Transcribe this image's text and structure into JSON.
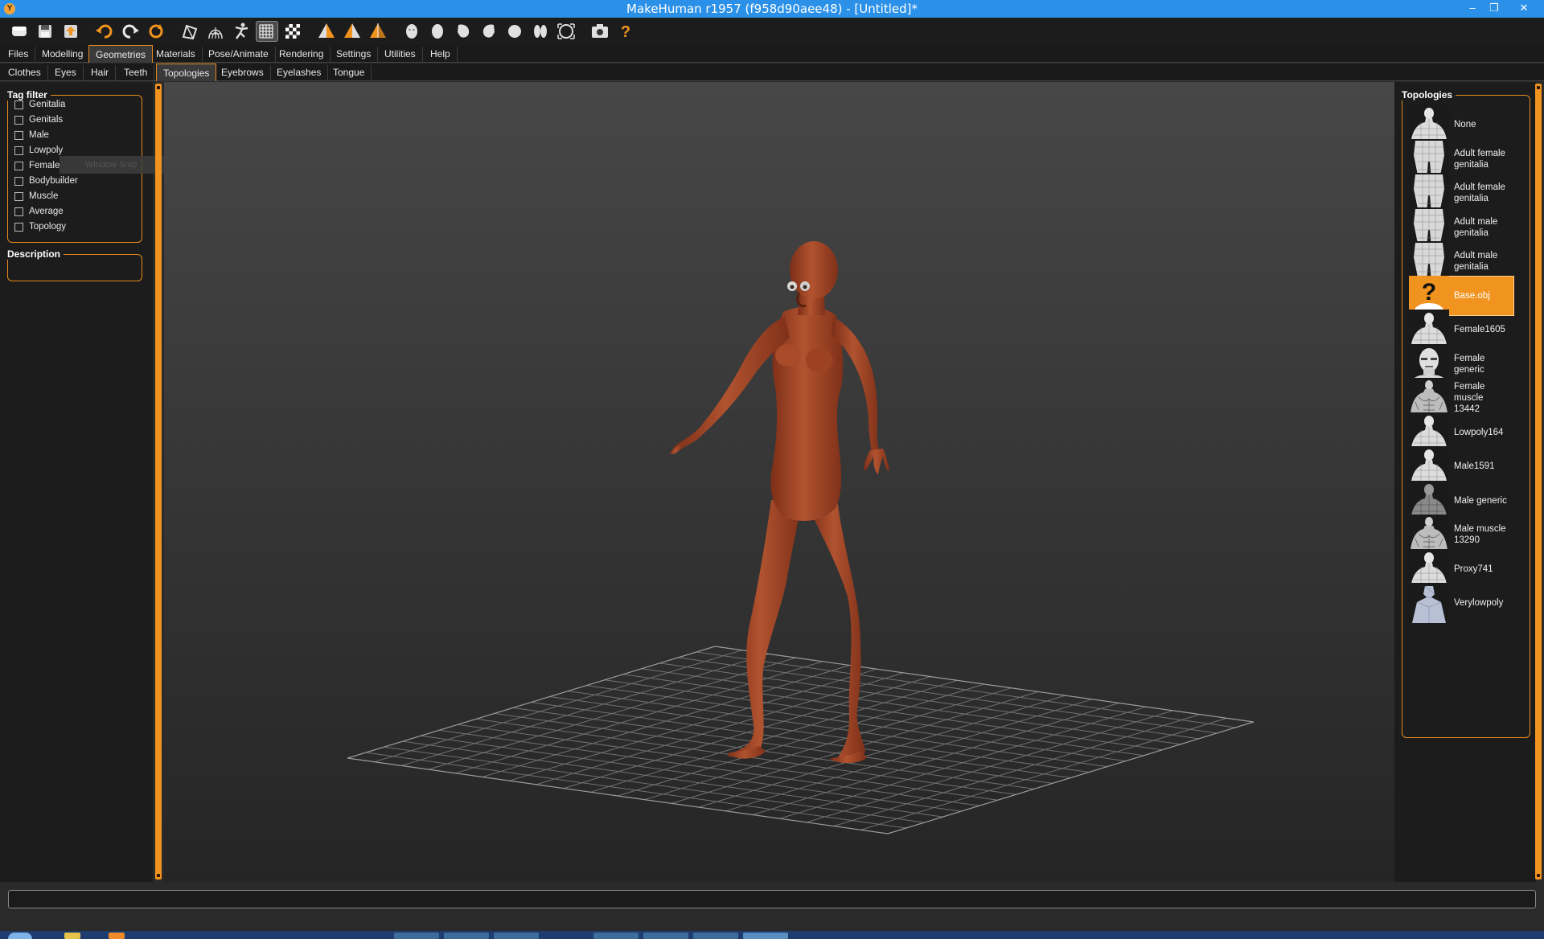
{
  "window": {
    "title": "MakeHuman r1957 (f958d90aee48) - [Untitled]*",
    "app_icon": "makehuman-logo-icon",
    "controls": [
      "minimize-icon",
      "restore-icon",
      "close-icon"
    ]
  },
  "toolbar": {
    "buttons": [
      {
        "name": "new-icon"
      },
      {
        "name": "save-icon"
      },
      {
        "name": "export-icon"
      },
      {
        "name": "undo-icon"
      },
      {
        "name": "redo-icon"
      },
      {
        "name": "reset-icon"
      },
      {
        "name": "smooth-icon"
      },
      {
        "name": "wireframe-icon"
      },
      {
        "name": "pose-icon"
      },
      {
        "name": "grid-icon",
        "active": true
      },
      {
        "name": "checker-background-icon"
      },
      {
        "name": "symmetry-right-icon"
      },
      {
        "name": "symmetry-left-icon"
      },
      {
        "name": "symmetry-icon"
      },
      {
        "name": "front-view-icon"
      },
      {
        "name": "back-view-icon"
      },
      {
        "name": "left-view-icon"
      },
      {
        "name": "right-view-icon"
      },
      {
        "name": "top-view-icon"
      },
      {
        "name": "bottom-view-icon"
      },
      {
        "name": "reset-camera-icon"
      },
      {
        "name": "screenshot-icon"
      },
      {
        "name": "help-icon"
      }
    ]
  },
  "menu": {
    "tabs": [
      "Files",
      "Modelling",
      "Geometries",
      "Materials",
      "Pose/Animate",
      "Rendering",
      "Settings",
      "Utilities",
      "Help"
    ],
    "active": "Geometries"
  },
  "subtabs": {
    "tabs": [
      "Clothes",
      "Eyes",
      "Hair",
      "Teeth",
      "Topologies",
      "Eyebrows",
      "Eyelashes",
      "Tongue"
    ],
    "active": "Topologies"
  },
  "left_panel": {
    "tag_filter": {
      "title": "Tag filter",
      "tags": [
        "Genitalia",
        "Genitals",
        "Male",
        "Lowpoly",
        "Female",
        "Bodybuilder",
        "Muscle",
        "Average",
        "Topology"
      ]
    },
    "description": {
      "title": "Description"
    },
    "tooltip": "Window Snip"
  },
  "right_panel": {
    "title": "Topologies",
    "items": [
      {
        "label": "None",
        "thumb": "male"
      },
      {
        "label": "Adult female\ngenitalia",
        "thumb": "torso"
      },
      {
        "label": "Adult female\ngenitalia",
        "thumb": "torso"
      },
      {
        "label": "Adult male\ngenitalia",
        "thumb": "torso"
      },
      {
        "label": "Adult male\ngenitalia",
        "thumb": "torso"
      },
      {
        "label": "Base.obj",
        "thumb": "unknown",
        "selected": true
      },
      {
        "label": "Female1605",
        "thumb": "male"
      },
      {
        "label": "Female\ngeneric",
        "thumb": "head"
      },
      {
        "label": "Female\nmuscle\n13442",
        "thumb": "muscle"
      },
      {
        "label": "Lowpoly164",
        "thumb": "male"
      },
      {
        "label": "Male1591",
        "thumb": "male"
      },
      {
        "label": "Male generic",
        "thumb": "male-dark"
      },
      {
        "label": "Male muscle\n13290",
        "thumb": "muscle"
      },
      {
        "label": "Proxy741",
        "thumb": "male"
      },
      {
        "label": "Verylowpoly",
        "thumb": "low"
      }
    ]
  },
  "colors": {
    "accent": "#f0931f",
    "skin": "#a4462a",
    "titlebar": "#2b90e8"
  }
}
